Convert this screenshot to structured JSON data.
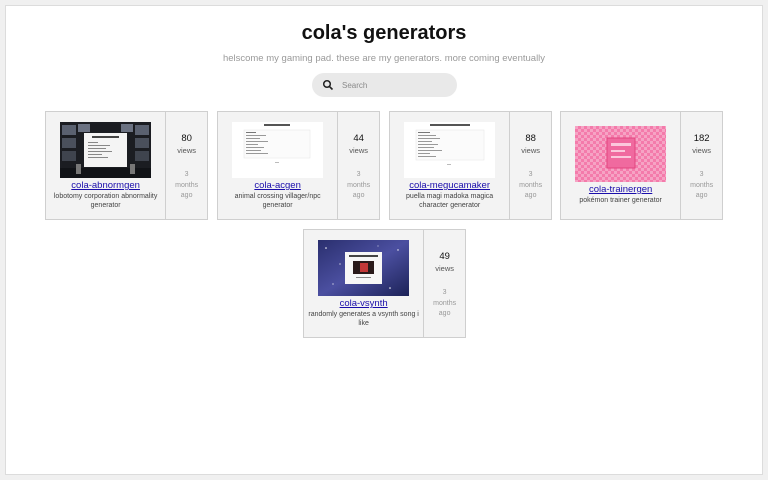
{
  "header": {
    "title": "cola's generators",
    "subtitle": "helscome my gaming pad. these are my generators. more coming eventually"
  },
  "search": {
    "placeholder": "Search"
  },
  "generators": [
    {
      "name": "cola-abnormgen",
      "description": "lobotomy corporation abnormality generator",
      "views": "80",
      "views_label": "views",
      "age_num": "3",
      "age_unit": "months",
      "age_suffix": "ago"
    },
    {
      "name": "cola-acgen",
      "description": "animal crossing villager/npc generator",
      "views": "44",
      "views_label": "views",
      "age_num": "3",
      "age_unit": "months",
      "age_suffix": "ago"
    },
    {
      "name": "cola-megucamaker",
      "description": "puella magi madoka magica character generator",
      "views": "88",
      "views_label": "views",
      "age_num": "3",
      "age_unit": "months",
      "age_suffix": "ago"
    },
    {
      "name": "cola-trainergen",
      "description": "pokémon trainer generator",
      "views": "182",
      "views_label": "views",
      "age_num": "3",
      "age_unit": "months",
      "age_suffix": "ago"
    },
    {
      "name": "cola-vsynth",
      "description": "randomly generates a vsynth song i like",
      "views": "49",
      "views_label": "views",
      "age_num": "3",
      "age_unit": "months",
      "age_suffix": "ago"
    }
  ],
  "colors": {
    "link": "#1a0dab",
    "card_bg": "#f3f3f3",
    "trainer_pink": "#f47bab"
  }
}
